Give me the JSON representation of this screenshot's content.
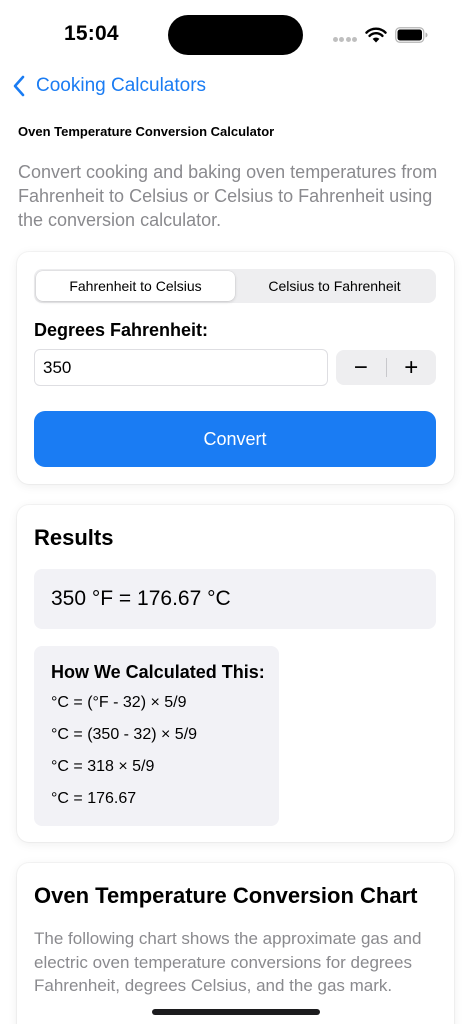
{
  "status_bar": {
    "time": "15:04",
    "icons": [
      "signal-dots-icon",
      "wifi-icon",
      "battery-icon"
    ]
  },
  "nav": {
    "back_label": "Cooking Calculators",
    "back_icon": "chevron-left-icon"
  },
  "page": {
    "title": "Oven Temperature Conversion Calculator",
    "intro": "Convert cooking and baking oven temperatures from Fahrenheit to Celsius or Celsius to Fahrenheit using the conversion calculator."
  },
  "converter": {
    "modes": [
      {
        "label": "Fahrenheit to Celsius",
        "selected": true
      },
      {
        "label": "Celsius to Fahrenheit",
        "selected": false
      }
    ],
    "field_label": "Degrees Fahrenheit:",
    "input_value": "350",
    "stepper": {
      "minus": "−",
      "plus": "+"
    },
    "convert_label": "Convert"
  },
  "results": {
    "heading": "Results",
    "result": "350 °F = 176.67 °C",
    "calc_title": "How We Calculated This:",
    "steps": [
      "°C = (°F - 32) × 5/9",
      "°C = (350 - 32) × 5/9",
      "°C = 318 × 5/9",
      "°C = 176.67"
    ]
  },
  "chart_section": {
    "heading": "Oven Temperature Conversion Chart",
    "description": "The following chart shows the approximate gas and electric oven temperature conversions for degrees Fahrenheit, degrees Celsius, and the gas mark."
  },
  "colors": {
    "accent": "#1a7cf3",
    "secondary_text": "#8a8a8e",
    "panel_background": "#f2f2f6"
  }
}
